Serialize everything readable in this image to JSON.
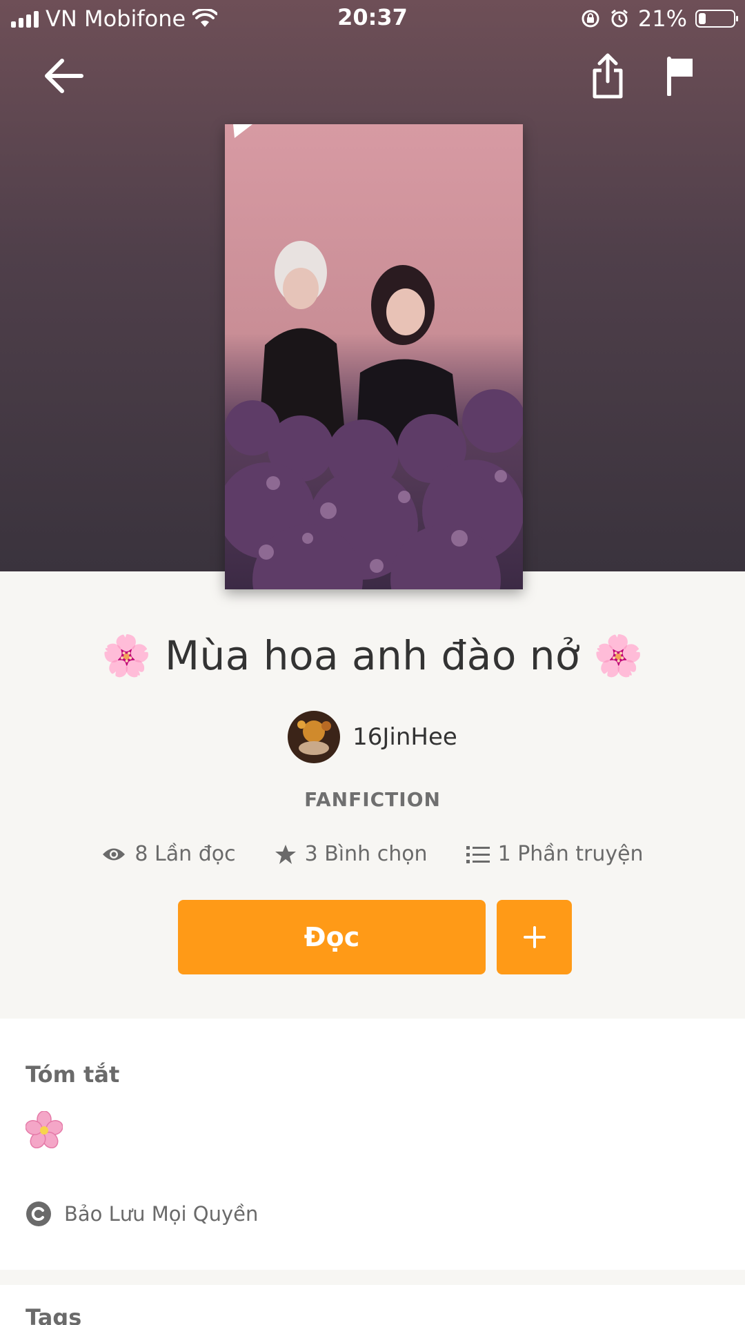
{
  "status_bar": {
    "carrier": "VN Mobifone",
    "time": "20:37",
    "battery_percent": "21%",
    "battery_level": 0.21
  },
  "nav": {
    "back_icon": "arrow-left-icon",
    "share_icon": "share-icon",
    "report_icon": "flag-icon"
  },
  "story": {
    "title": "🌸 Mùa hoa anh đào nở 🌸",
    "author": "16JinHee",
    "category": "FANFICTION",
    "stats": {
      "reads": "8 Lần đọc",
      "votes": "3 Bình chọn",
      "parts": "1 Phần truyện"
    },
    "read_label": "Đọc",
    "add_label": "+"
  },
  "summary": {
    "heading": "Tóm tắt",
    "text": "🌸",
    "copyright": "Bảo Lưu Mọi Quyền"
  },
  "tags": {
    "heading": "Tags"
  },
  "colors": {
    "accent": "#ff9a17",
    "hero_top": "#6e4f57",
    "hero_bottom": "#3a333d"
  }
}
